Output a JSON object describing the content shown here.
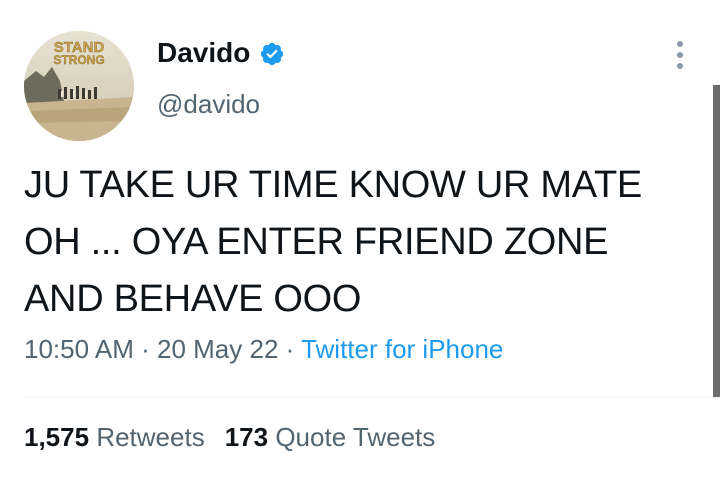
{
  "author": {
    "display_name": "Davido",
    "handle": "@davido",
    "avatar_text_line1": "STAND",
    "avatar_text_line2": "STRONG",
    "verified_icon": "verified-badge-icon"
  },
  "tweet": {
    "text": "JU TAKE UR TIME KNOW UR MATE OH ... OYA ENTER FRIEND ZONE AND BEHAVE OOO",
    "time": "10:50 AM",
    "date": "20 May 22",
    "separator": "·",
    "source": "Twitter for iPhone"
  },
  "stats": {
    "retweets_count": "1,575",
    "retweets_label": "Retweets",
    "quotes_count": "173",
    "quotes_label": "Quote Tweets"
  },
  "colors": {
    "primary_text": "#0f1419",
    "secondary_text": "#536471",
    "link": "#1d9bf0",
    "verified": "#1d9bf0"
  }
}
